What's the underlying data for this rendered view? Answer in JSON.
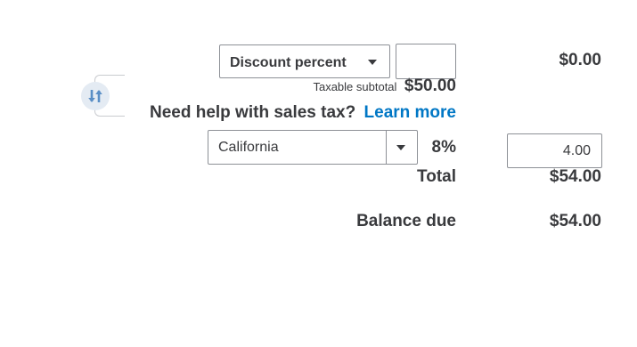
{
  "discount": {
    "type_label": "Discount percent",
    "input_value": "",
    "amount": "$0.00"
  },
  "taxable_subtotal": {
    "label": "Taxable subtotal",
    "value": "$50.00"
  },
  "help": {
    "text": "Need help with sales tax?",
    "link_label": "Learn more"
  },
  "tax": {
    "rate_name": "California",
    "rate_percent": "8%",
    "amount_value": "4.00"
  },
  "total": {
    "label": "Total",
    "value": "$54.00"
  },
  "balance_due": {
    "label": "Balance due",
    "value": "$54.00"
  },
  "icons": {
    "swap": "swap-arrows-icon",
    "dropdown": "chevron-down-icon"
  },
  "colors": {
    "link": "#0077c5",
    "text": "#393a3d",
    "border": "#8d9096",
    "icon_bg": "#e4ebf3",
    "icon_fg": "#5a8fc6"
  }
}
